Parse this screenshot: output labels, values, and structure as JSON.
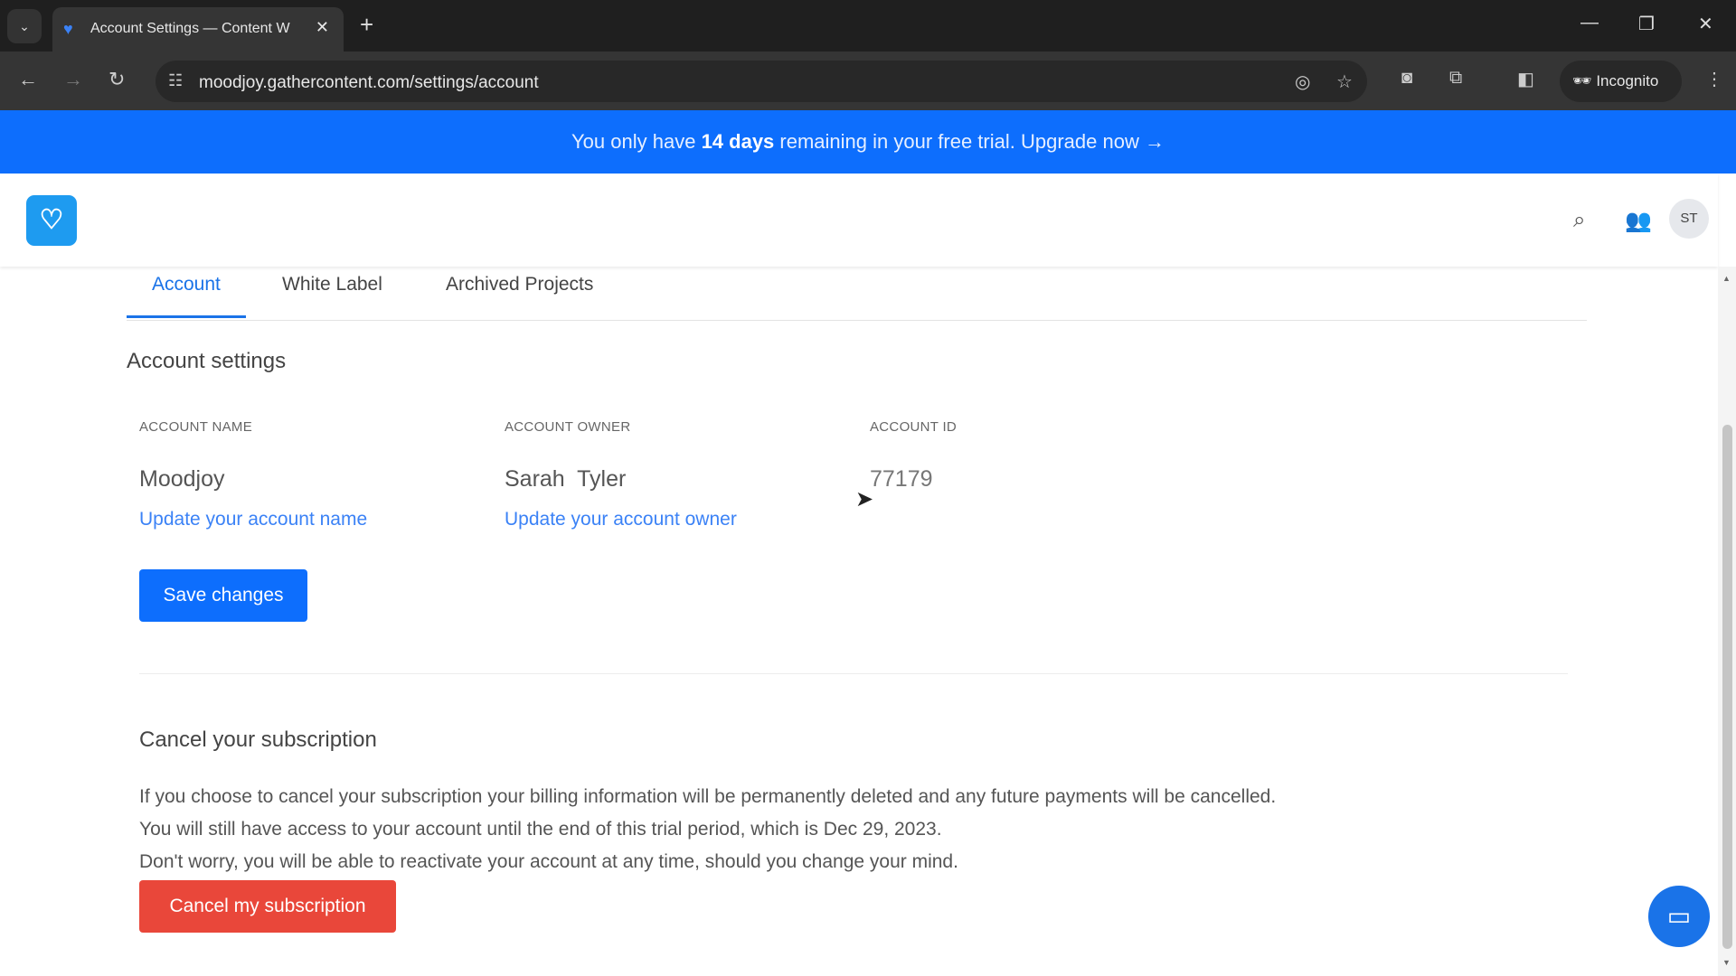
{
  "browser": {
    "tab_title": "Account Settings — Content W",
    "url": "moodjoy.gathercontent.com/settings/account",
    "incognito_label": "Incognito"
  },
  "banner": {
    "prefix": "You only have ",
    "days": "14 days",
    "suffix": " remaining in your free trial. Upgrade now →"
  },
  "header": {
    "avatar_initials": "ST"
  },
  "tabs": [
    {
      "label": "Account",
      "active": true
    },
    {
      "label": "White Label"
    },
    {
      "label": "Archived Projects"
    }
  ],
  "account": {
    "title": "Account settings",
    "name_label": "ACCOUNT NAME",
    "name_value": "Moodjoy",
    "name_link": "Update your account name",
    "owner_label": "ACCOUNT OWNER",
    "owner_value": "Sarah  Tyler",
    "owner_link": "Update your account owner",
    "id_label": "ACCOUNT ID",
    "id_value": "77179",
    "save_label": "Save changes"
  },
  "cancel": {
    "title": "Cancel your subscription",
    "lines": [
      "If you choose to cancel your subscription your billing information will be permanently deleted and any future payments will be cancelled.",
      "You will still have access to your account until the end of this trial period, which is Dec 29, 2023.",
      "Don't worry, you will be able to reactivate your account at any time, should you change your mind."
    ],
    "button_label": "Cancel my subscription"
  },
  "colors": {
    "primary": "#0d6efd",
    "danger": "#e9473a",
    "link": "#3b82f6"
  }
}
